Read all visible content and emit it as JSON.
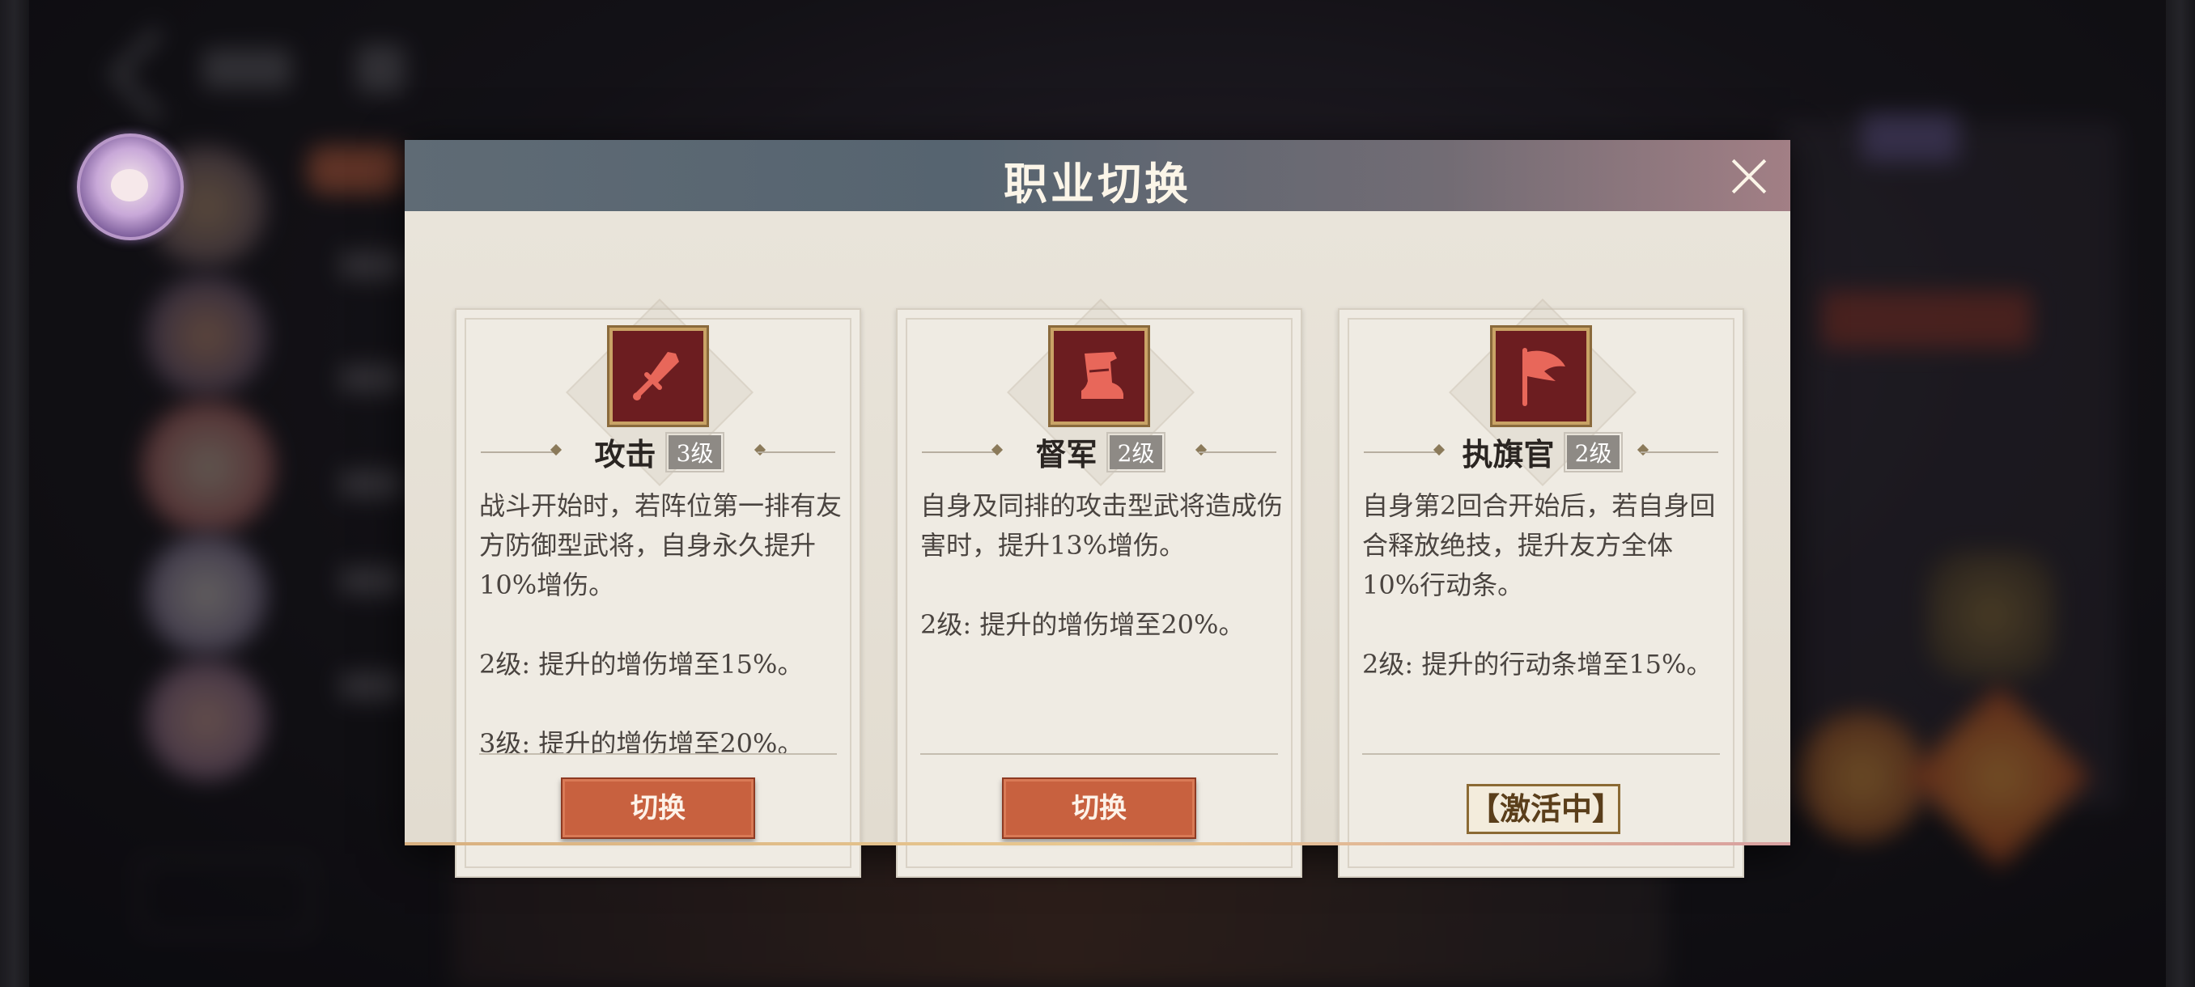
{
  "modal": {
    "title": "职业切换"
  },
  "cards": [
    {
      "icon": "sword-icon",
      "name": "攻击",
      "level": "3级",
      "description": "战斗开始时，若阵位第一排有友方防御型武将，自身永久提升10%增伤。\n\n2级: 提升的增伤增至15%。\n\n3级: 提升的增伤增至20%。",
      "action_label": "切换"
    },
    {
      "icon": "boot-icon",
      "name": "督军",
      "level": "2级",
      "description": "自身及同排的攻击型武将造成伤害时，提升13%增伤。\n\n2级: 提升的增伤增至20%。",
      "action_label": "切换"
    },
    {
      "icon": "flag-icon",
      "name": "执旗官",
      "level": "2级",
      "description": "自身第2回合开始后，若自身回合释放绝技，提升友方全体10%行动条。\n\n2级: 提升的行动条增至15%。",
      "status_label": "【激活中】"
    }
  ],
  "colors": {
    "switch_button": "#c8613f",
    "icon_bg": "#6c1d20",
    "icon_symbol": "#e8675a",
    "header": "#5f6b75"
  }
}
